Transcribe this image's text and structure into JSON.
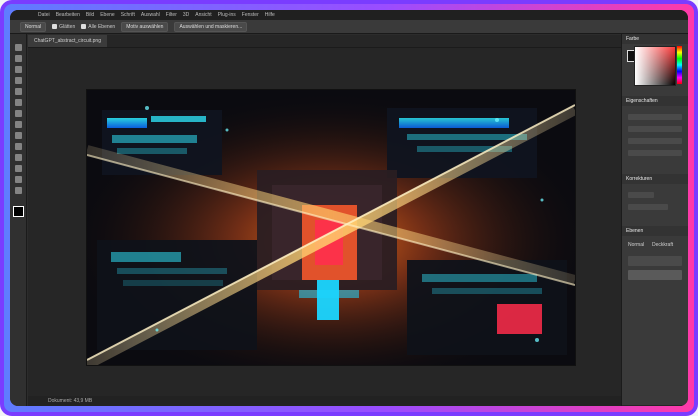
{
  "app": {
    "menu": [
      "Datei",
      "Bearbeiten",
      "Bild",
      "Ebene",
      "Schrift",
      "Auswahl",
      "Filter",
      "3D",
      "Ansicht",
      "Plug-ins",
      "Fenster",
      "Hilfe"
    ],
    "options": {
      "tool": "Auswahl",
      "mode": "Normal",
      "antialias_label": "Glätten",
      "sample_label": "Alle Ebenen",
      "select_subject": "Motiv auswählen",
      "select_and_mask": "Auswählen und maskieren..."
    },
    "document_tab": "ChatGPT_abstract_circuit.png",
    "status": "Dokument: 43,9 MB",
    "panels": {
      "color": "Farbe",
      "swatches": "Farbfelder",
      "properties": "Eigenschaften",
      "adjustments": "Korrekturen",
      "layers": "Ebenen",
      "layers_tabs": [
        "Ebenen",
        "Kanäle"
      ],
      "normal": "Normal",
      "opacity": "Deckkraft"
    },
    "colors": {
      "frame": "#7a3cff",
      "accent_orange": "#ff9a1f",
      "accent_cyan": "#19d6ff",
      "accent_red": "#ff2f4d"
    }
  }
}
